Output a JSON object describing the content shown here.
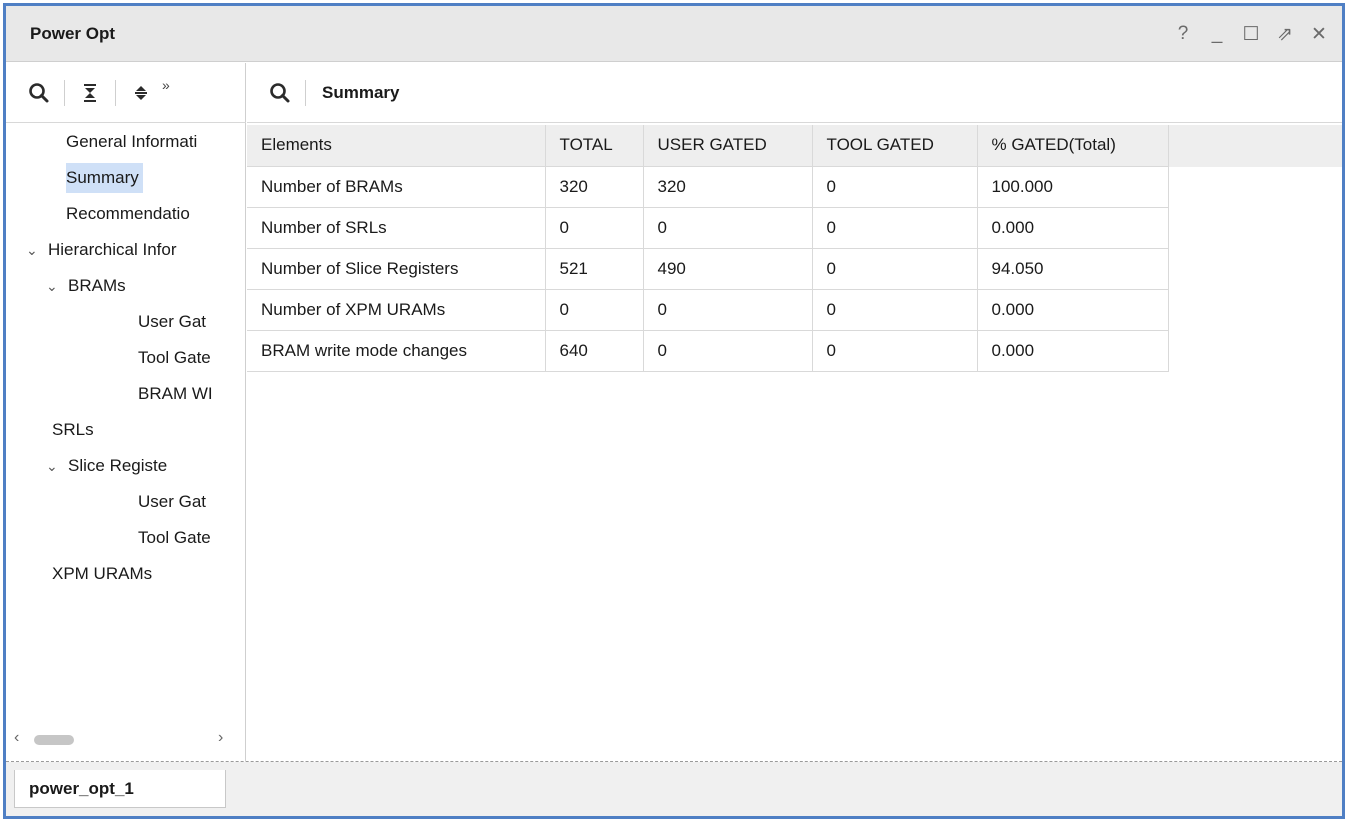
{
  "window": {
    "title": "Power Opt",
    "controls": [
      {
        "name": "help-icon",
        "glyph": "?"
      },
      {
        "name": "minimize-icon",
        "glyph": "_"
      },
      {
        "name": "maximize-icon",
        "glyph": "☐"
      },
      {
        "name": "float-icon",
        "glyph": "⇗"
      },
      {
        "name": "close-icon",
        "glyph": "✕"
      }
    ]
  },
  "left_toolbar": {
    "icons": [
      "search-icon",
      "collapse-all-icon",
      "expand-all-icon"
    ],
    "more": "»"
  },
  "tree": [
    {
      "label": "General Informati",
      "level": 0,
      "expandable": false,
      "selected": false
    },
    {
      "label": "Summary",
      "level": 0,
      "expandable": false,
      "selected": true
    },
    {
      "label": "Recommendatio",
      "level": 0,
      "expandable": false,
      "selected": false
    },
    {
      "label": "Hierarchical Infor",
      "level": 0,
      "expandable": true,
      "selected": false
    },
    {
      "label": "BRAMs",
      "level": 1,
      "expandable": true,
      "selected": false
    },
    {
      "label": "User Gat",
      "level": 2,
      "expandable": false,
      "selected": false
    },
    {
      "label": "Tool Gate",
      "level": 2,
      "expandable": false,
      "selected": false
    },
    {
      "label": "BRAM WI",
      "level": 2,
      "expandable": false,
      "selected": false
    },
    {
      "label": "SRLs",
      "level": 1,
      "expandable": false,
      "selected": false
    },
    {
      "label": "Slice Registe",
      "level": 1,
      "expandable": true,
      "selected": false
    },
    {
      "label": "User Gat",
      "level": 2,
      "expandable": false,
      "selected": false
    },
    {
      "label": "Tool Gate",
      "level": 2,
      "expandable": false,
      "selected": false
    },
    {
      "label": "XPM URAMs",
      "level": 1,
      "expandable": false,
      "selected": false
    }
  ],
  "right_toolbar": {
    "title": "Summary"
  },
  "table": {
    "columns": [
      "Elements",
      "TOTAL",
      "USER GATED",
      "TOOL GATED",
      "% GATED(Total)"
    ],
    "rows": [
      [
        "Number of BRAMs",
        "320",
        "320",
        "0",
        "100.000"
      ],
      [
        "Number of SRLs",
        "0",
        "0",
        "0",
        "0.000"
      ],
      [
        "Number of Slice Registers",
        "521",
        "490",
        "0",
        "94.050"
      ],
      [
        "Number of XPM URAMs",
        "0",
        "0",
        "0",
        "0.000"
      ],
      [
        "BRAM write mode changes",
        "640",
        "0",
        "0",
        "0.000"
      ]
    ]
  },
  "bottom_tab": {
    "label": "power_opt_1"
  },
  "colors": {
    "accent": "#4f7fc4",
    "selection": "#cfe0f7",
    "header_bg": "#eeeeee"
  }
}
